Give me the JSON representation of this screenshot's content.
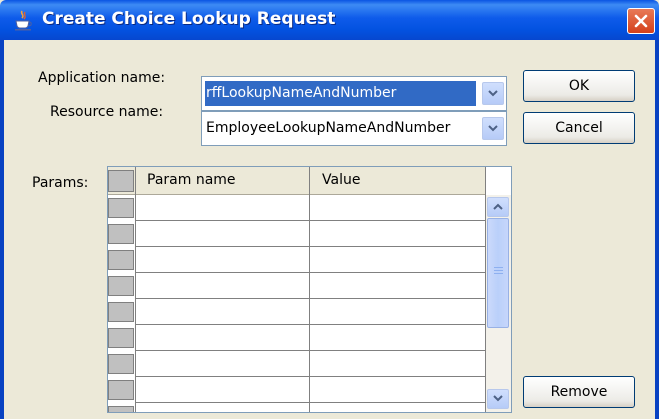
{
  "window": {
    "title": "Create Choice Lookup Request",
    "title_icon": "java-cup-icon",
    "close_icon": "close-icon",
    "accent_color": "#0A54E3"
  },
  "form": {
    "application_label": "Application name:",
    "application_value": "rffLookupNameAndNumber",
    "resource_label": "Resource name:",
    "resource_value": "EmployeeLookupNameAndNumber",
    "params_label": "Params:"
  },
  "buttons": {
    "ok": "OK",
    "cancel": "Cancel",
    "remove": "Remove"
  },
  "params_table": {
    "columns": [
      "Param name",
      "Value"
    ],
    "rows": [
      {
        "param_name": "",
        "value": ""
      },
      {
        "param_name": "",
        "value": ""
      },
      {
        "param_name": "",
        "value": ""
      },
      {
        "param_name": "",
        "value": ""
      },
      {
        "param_name": "",
        "value": ""
      },
      {
        "param_name": "",
        "value": ""
      },
      {
        "param_name": "",
        "value": ""
      },
      {
        "param_name": "",
        "value": ""
      }
    ]
  }
}
